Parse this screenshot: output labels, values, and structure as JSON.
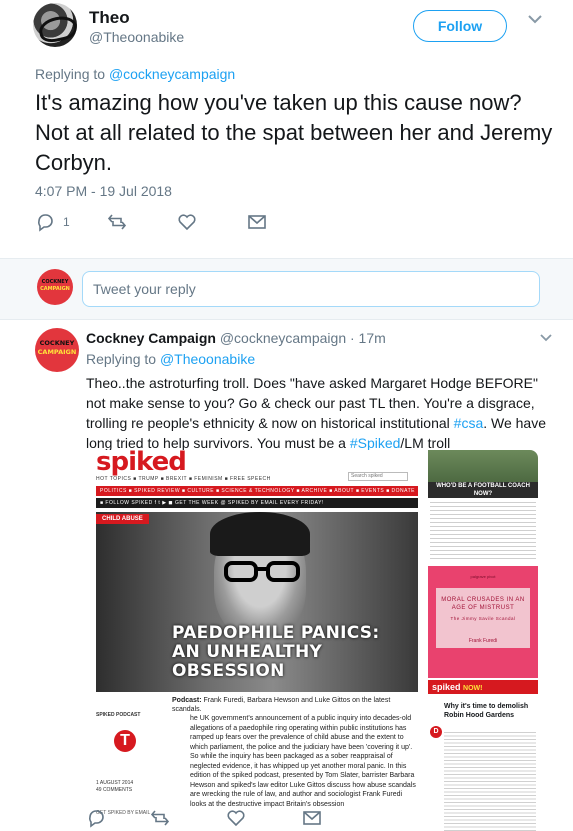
{
  "main_tweet": {
    "author_name": "Theo",
    "author_handle": "@Theoonabike",
    "follow_label": "Follow",
    "replying_prefix": "Replying to ",
    "replying_to": "@cockneycampaign",
    "text": "It's amazing how you've taken up this cause now? Not at all related to the spat between her and Jeremy Corbyn.",
    "timestamp": "4:07 PM - 19 Jul 2018",
    "reply_count": "1"
  },
  "composer": {
    "avatar_text_top": "COCKNEY",
    "avatar_text_bottom": "CAMPAIGN",
    "placeholder": "Tweet your reply"
  },
  "reply_tweet": {
    "author_name": "Cockney Campaign",
    "author_meta": "@cockneycampaign · 17m",
    "avatar_text_top": "COCKNEY",
    "avatar_text_bottom": "CAMPAIGN",
    "replying_prefix": "Replying to ",
    "replying_to": "@Theoonabike",
    "text_part1": "Theo..the astroturfing troll. Does \"have asked Margaret Hodge BEFORE\" not make sense to you? Go & check our past TL then. You're a disgrace, trolling re people's ethnicity & now on historical institutional ",
    "hashtag_csa": "#csa",
    "text_part2": ". We have long tried to help survivors. You must be a ",
    "hashtag_spiked": "#Spiked",
    "text_part3": "/LM troll"
  },
  "embedded_image": {
    "logo": "spiked",
    "nav": "HOT TOPICS  ■ TRUMP  ■ BREXIT  ■ FEMINISM  ■ FREE SPEECH",
    "search_placeholder": "Search spiked",
    "red_bar": "POLITICS ■ SPIKED REVIEW ■ CULTURE ■ SCIENCE & TECHNOLOGY ■ ARCHIVE ■ ABOUT ■ EVENTS ■ DONATE",
    "black_bar": "■ FOLLOW SPIKED   f  t  ▶  ◼   GET THE WEEK @ SPIKED BY EMAIL EVERY FRIDAY!",
    "tag": "CHILD ABUSE",
    "headline_line1": "PAEDOPHILE PANICS:",
    "headline_line2": "AN UNHEALTHY",
    "headline_line3": "OBSESSION",
    "podcast_label": "Podcast:",
    "podcast_text": " Frank Furedi, Barbara Hewson and Luke Gittos on the latest scandals.",
    "section_label": "SPIKED PODCAST",
    "dropcap": "T",
    "body": "he UK government's announcement of a public inquiry into decades-old allegations of a paedophile ring operating within public institutions has ramped up fears over the prevalence of child abuse and the extent to which parliament, the police and the judiciary have been 'covering it up'. So while the inquiry has been packaged as a sober reappraisal of neglected evidence, it has whipped up yet another moral panic. In this edition of the spiked podcast, presented by Tom Slater, barrister Barbara Hewson and spiked's law editor Luke Gittos discuss how abuse scandals are wrecking the rule of law, and author and sociologist Frank Furedi looks at the destructive impact Britain's obsession",
    "date": "1 AUGUST 2014",
    "comments": "49 COMMENTS",
    "get_by_email": "GET SPIKED BY EMAIL",
    "coach_caption": "WHO'D BE A FOOTBALL COACH NOW?",
    "book_publisher": "palgrave pivot",
    "book_title": "MORAL CRUSADES IN AN AGE OF MISTRUST",
    "book_subtitle": "The Jimmy Savile Scandal",
    "book_author": "Frank Furedi",
    "ad_logo": "spiked",
    "ad_now": "NOW!",
    "robin_headline": "Why it's time to demolish Robin Hood Gardens",
    "robin_dropcap": "D"
  }
}
